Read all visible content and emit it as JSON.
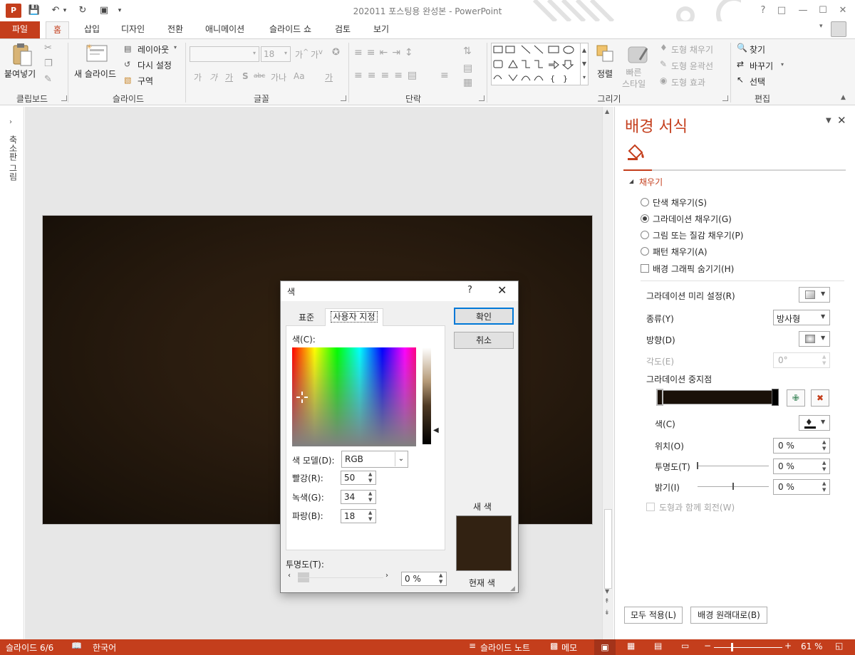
{
  "window": {
    "title": "202011 포스팅용 완성본 - PowerPoint",
    "app_icon": "P"
  },
  "tabs": [
    "파일",
    "홈",
    "삽입",
    "디자인",
    "전환",
    "애니메이션",
    "슬라이드 쇼",
    "검토",
    "보기"
  ],
  "ribbon": {
    "clipboard": {
      "paste": "붙여넣기",
      "group": "클립보드"
    },
    "slides": {
      "new_slide": "새 슬라이드",
      "layout": "레이아웃",
      "reset": "다시 설정",
      "section": "구역",
      "group": "슬라이드"
    },
    "font": {
      "size": "18",
      "group": "글꼴",
      "format_buttons": [
        "가",
        "가",
        "가",
        "S",
        "abc",
        "가나",
        "Aa",
        "가"
      ]
    },
    "paragraph": {
      "group": "단락"
    },
    "drawing": {
      "arrange": "정렬",
      "quick_style": "빠른\n스타일",
      "shape_fill": "도형 채우기",
      "shape_outline": "도형 윤곽선",
      "shape_effect": "도형 효과",
      "group": "그리기"
    },
    "editing": {
      "find": "찾기",
      "replace": "바꾸기",
      "select": "선택",
      "group": "편집"
    }
  },
  "left_rail": {
    "label": "축소판 그림"
  },
  "format_pane": {
    "title": "배경 서식",
    "section": "채우기",
    "fill_options": [
      "단색 채우기(S)",
      "그라데이션 채우기(G)",
      "그림 또는 질감 채우기(P)",
      "패턴 채우기(A)"
    ],
    "selected_fill": "그라데이션 채우기(G)",
    "hide_graphics": "배경 그래픽 숨기기(H)",
    "preset_label": "그라데이션 미리 설정(R)",
    "type_label": "종류(Y)",
    "type_value": "방사형",
    "direction_label": "방향(D)",
    "angle_label": "각도(E)",
    "angle_value": "0°",
    "stops_label": "그라데이션 중지점",
    "color_label": "색(C)",
    "position_label": "위치(O)",
    "position_value": "0 %",
    "transparency_label": "투명도(T)",
    "transparency_value": "0 %",
    "brightness_label": "밝기(I)",
    "brightness_value": "0 %",
    "rotate_with_shape": "도형과 함께 회전(W)",
    "apply_all": "모두 적용(L)",
    "reset_background": "배경 원래대로(B)"
  },
  "dialog": {
    "title": "색",
    "help": "?",
    "tabs": [
      "표준",
      "사용자 지정"
    ],
    "active_tab": "사용자 지정",
    "ok": "확인",
    "cancel": "취소",
    "colors_label": "색(C):",
    "model_label": "색 모델(D):",
    "model_value": "RGB",
    "red_label": "빨강(R):",
    "red": "50",
    "green_label": "녹색(G):",
    "green": "34",
    "blue_label": "파랑(B):",
    "blue": "18",
    "transparency_label": "투명도(T):",
    "transparency_value": "0 %",
    "new_label": "새 색",
    "current_label": "현재 색",
    "new_color": "#322212",
    "current_color": "#322212"
  },
  "status": {
    "slide": "슬라이드 6/6",
    "language": "한국어",
    "notes": "슬라이드 노트",
    "comments": "메모",
    "zoom": "61 %"
  },
  "colors": {
    "accent": "#c43e1c",
    "slide_bg": "#2a1c0f"
  }
}
